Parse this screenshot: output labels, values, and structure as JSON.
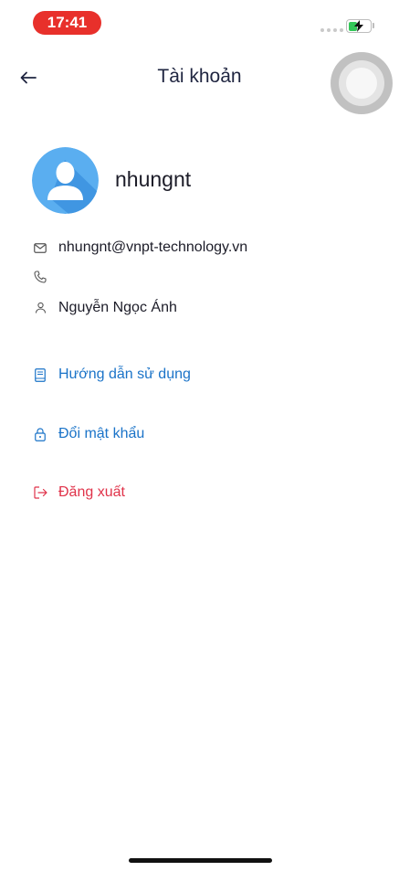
{
  "status_bar": {
    "time": "17:41",
    "battery_level": 0.4,
    "colors": {
      "time_pill": "#e8302b",
      "battery": "#34c759"
    }
  },
  "header": {
    "title": "Tài khoản",
    "back_icon": "arrow-left-icon"
  },
  "profile": {
    "username": "nhungnt",
    "avatar_icon": "user-avatar-icon",
    "email": "nhungnt@vnpt-technology.vn",
    "phone": "",
    "full_name": "Nguyễn Ngọc Ánh"
  },
  "actions": {
    "guide_label": "Hướng dẫn sử dụng",
    "change_password_label": "Đổi mật khẩu",
    "logout_label": "Đăng xuất"
  },
  "colors": {
    "accent": "#1a73c8",
    "danger": "#e0334a",
    "avatar_bg": "#5aaef0"
  }
}
